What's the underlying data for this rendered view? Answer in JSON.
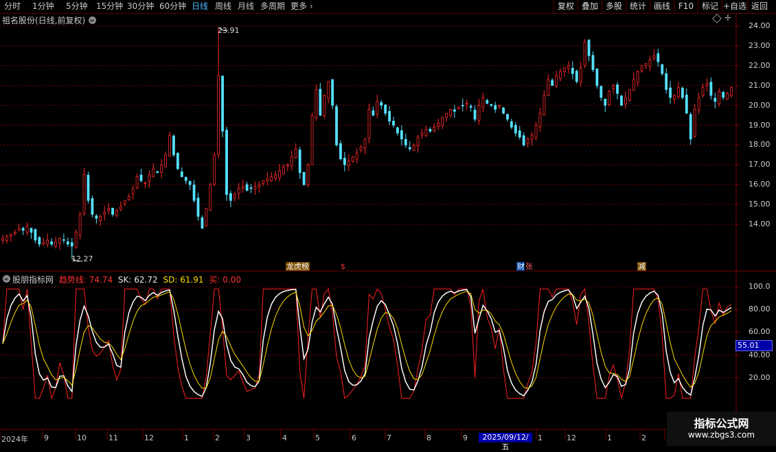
{
  "toolbar": {
    "periods": [
      "分时",
      "1分钟",
      "5分钟",
      "15分钟",
      "30分钟",
      "60分钟",
      "日线",
      "周线",
      "月线",
      "多周期",
      "更多"
    ],
    "active_period": "日线",
    "right_buttons": [
      "复权",
      "叠加",
      "多股",
      "统计",
      "画线",
      "F10",
      "标记",
      "+自选",
      "返回"
    ]
  },
  "stock": {
    "name": "祖名股份",
    "mode": "(日线,前复权)",
    "high_label": "23.91",
    "low_label": "12.27"
  },
  "price_axis": [
    "24.00",
    "23.00",
    "22.00",
    "21.00",
    "20.00",
    "19.00",
    "18.00",
    "17.00",
    "16.00",
    "15.00",
    "14.00"
  ],
  "markers": [
    {
      "text": "龙虎榜",
      "color": "#ffffff",
      "bg": "#7a4a00"
    },
    {
      "text": "$",
      "color": "#ff3030",
      "bg": "#000000"
    },
    {
      "text": "财",
      "color": "#ffffff",
      "bg": "#0040a0"
    },
    {
      "text": "张",
      "color": "#ff6060",
      "bg": "#000000"
    },
    {
      "text": "减",
      "color": "#ffffff",
      "bg": "#7a4a00"
    }
  ],
  "indicator": {
    "name": "股朋指标网",
    "trend_label": "趋势线:",
    "trend_value": "74.74",
    "sk_label": "SK:",
    "sk_value": "62.72",
    "sd_label": "SD:",
    "sd_value": "61.91",
    "buy_label": "买:",
    "buy_value": "0.00",
    "axis": [
      "100.0",
      "80.00",
      "60.00",
      "40.00",
      "20.00"
    ],
    "current_value": "55.01"
  },
  "date_axis": {
    "labels": [
      "2024年",
      "9",
      "10",
      "11",
      "12",
      "1",
      "2",
      "3",
      "4",
      "5",
      "6",
      "7",
      "8",
      "9",
      "2025/09/12/五",
      "1",
      "12",
      "1",
      "2",
      "3"
    ],
    "highlight": "2025/09/12/五"
  },
  "watermark": {
    "title": "指标公式网",
    "url": "www.zbgs3.com"
  },
  "colors": {
    "up": "#ff2a2a",
    "down": "#54e0ff",
    "trend": "#ff2020",
    "sk": "#ffffff",
    "sd": "#ffe000",
    "grid": "#7a0000",
    "active": "#4db8ff"
  },
  "chart_data": {
    "type": "candlestick+line",
    "price_range": [
      12.27,
      23.91
    ],
    "close": [
      13.3,
      13.4,
      13.5,
      13.6,
      13.8,
      13.7,
      13.9,
      13.6,
      13.2,
      13.0,
      13.1,
      13.2,
      13.0,
      13.1,
      13.3,
      13.2,
      13.0,
      12.9,
      13.6,
      14.5,
      16.5,
      15.2,
      14.5,
      14.3,
      14.4,
      14.6,
      14.8,
      14.5,
      14.7,
      14.9,
      15.2,
      15.4,
      15.8,
      16.4,
      16.2,
      16.1,
      16.5,
      16.8,
      16.6,
      17.0,
      17.5,
      18.5,
      17.5,
      16.8,
      16.4,
      16.2,
      16.0,
      15.2,
      14.4,
      13.8,
      14.8,
      16.0,
      17.5,
      21.5,
      18.7,
      15.5,
      15.2,
      15.5,
      15.8,
      15.9,
      15.7,
      15.8,
      15.9,
      16.0,
      16.2,
      16.3,
      16.4,
      16.5,
      16.7,
      16.9,
      17.0,
      17.4,
      17.8,
      16.6,
      16.0,
      17.0,
      19.5,
      20.8,
      19.5,
      20.5,
      21.2,
      20.0,
      18.0,
      17.3,
      17.0,
      17.2,
      17.4,
      17.6,
      17.9,
      18.3,
      19.8,
      19.5,
      20.2,
      20.0,
      19.6,
      19.2,
      19.0,
      18.6,
      18.3,
      18.0,
      17.8,
      18.0,
      18.4,
      18.6,
      18.8,
      18.7,
      18.9,
      19.1,
      19.4,
      19.6,
      19.8,
      19.7,
      19.9,
      20.0,
      20.1,
      19.9,
      19.3,
      20.0,
      20.4,
      20.1,
      20.0,
      19.8,
      20.0,
      19.6,
      19.3,
      18.9,
      18.6,
      18.4,
      18.0,
      18.3,
      18.5,
      19.0,
      19.6,
      20.5,
      21.3,
      21.0,
      21.5,
      21.7,
      21.9,
      22.0,
      21.6,
      21.2,
      21.9,
      23.2,
      22.5,
      21.8,
      21.0,
      20.4,
      20.0,
      20.7,
      21.0,
      20.6,
      20.0,
      20.4,
      20.8,
      21.3,
      21.7,
      22.0,
      22.1,
      22.3,
      22.5,
      22.2,
      21.6,
      20.8,
      20.4,
      20.5,
      20.9,
      20.4,
      19.6,
      18.3,
      19.8,
      20.4,
      20.9,
      21.1,
      20.5,
      20.2,
      20.7,
      20.4,
      20.6,
      20.9
    ],
    "trend_series_ref": "趋势线",
    "sk_series_ref": "SK",
    "sd_series_ref": "SD",
    "indicator_range": [
      0,
      100
    ]
  }
}
